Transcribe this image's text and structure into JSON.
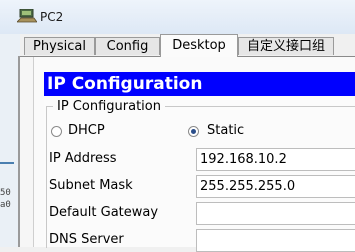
{
  "window": {
    "title": "PC2"
  },
  "tabs": [
    {
      "label": "Physical"
    },
    {
      "label": "Config"
    },
    {
      "label": "Desktop"
    },
    {
      "label": "自定义接口组"
    }
  ],
  "left_fragments": [
    "50",
    "a0"
  ],
  "ip_config": {
    "header": "IP Configuration",
    "group_label": "IP Configuration",
    "mode": {
      "options": [
        {
          "label": "DHCP",
          "selected": false
        },
        {
          "label": "Static",
          "selected": true
        }
      ]
    },
    "fields": [
      {
        "label": "IP Address",
        "value": "192.168.10.2"
      },
      {
        "label": "Subnet Mask",
        "value": "255.255.255.0"
      },
      {
        "label": "Default Gateway",
        "value": ""
      },
      {
        "label": "DNS Server",
        "value": ""
      }
    ]
  },
  "colors": {
    "header_bg": "#0000ff",
    "header_text": "#ffffff"
  },
  "icons": {
    "app": "computer-icon"
  }
}
